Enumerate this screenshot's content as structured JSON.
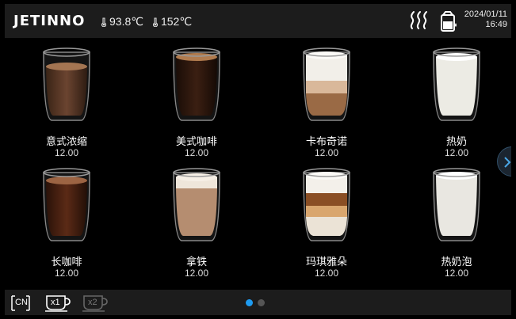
{
  "header": {
    "logo": "JETINNO",
    "temp_1": "93.8℃",
    "temp_2": "152℃",
    "date": "2024/01/11",
    "time": "16:49",
    "icons": [
      "steam-icon",
      "milk-container-icon"
    ]
  },
  "menu": {
    "items": [
      {
        "name": "意式浓缩",
        "price": "12.00",
        "drink": "espresso"
      },
      {
        "name": "美式咖啡",
        "price": "12.00",
        "drink": "americano"
      },
      {
        "name": "卡布奇诺",
        "price": "12.00",
        "drink": "cappuccino"
      },
      {
        "name": "热奶",
        "price": "12.00",
        "drink": "hot-milk"
      },
      {
        "name": "长咖啡",
        "price": "12.00",
        "drink": "long-coffee"
      },
      {
        "name": "拿铁",
        "price": "12.00",
        "drink": "latte"
      },
      {
        "name": "玛琪雅朵",
        "price": "12.00",
        "drink": "macchiato"
      },
      {
        "name": "热奶泡",
        "price": "12.00",
        "drink": "hot-milk-foam"
      }
    ]
  },
  "footer": {
    "language": "CN",
    "cup_single": "x1",
    "cup_double": "x2",
    "page_count": 2,
    "current_page": 1
  },
  "colors": {
    "accent": "#1e9bf0",
    "header_bg": "#1c1c1c"
  }
}
